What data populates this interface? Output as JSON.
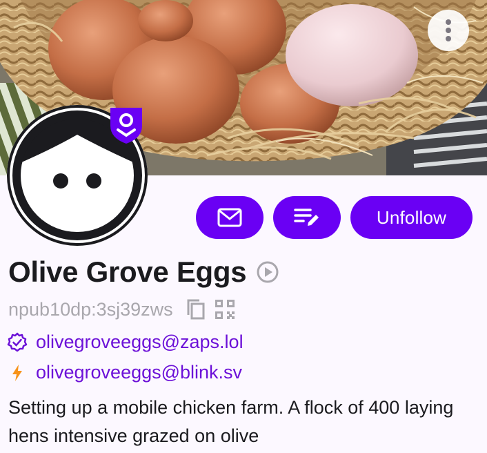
{
  "profile": {
    "name": "Olive Grove Eggs",
    "npub": "npub10dp:3sj39zws",
    "nip05": "olivegroveeggs@zaps.lol",
    "lud16": "olivegroveeggs@blink.sv",
    "about": "Setting up a mobile chicken farm. A flock of 400 laying hens intensive grazed on olive"
  },
  "actions": {
    "message_icon": "envelope-icon",
    "edit_list_icon": "edit-list-icon",
    "unfollow_label": "Unfollow"
  },
  "colors": {
    "accent": "#6a00f4",
    "link": "#6c11d8",
    "lightning": "#f7931a",
    "secondary_text": "#a9a7ad",
    "background": "#fcf8ff"
  }
}
